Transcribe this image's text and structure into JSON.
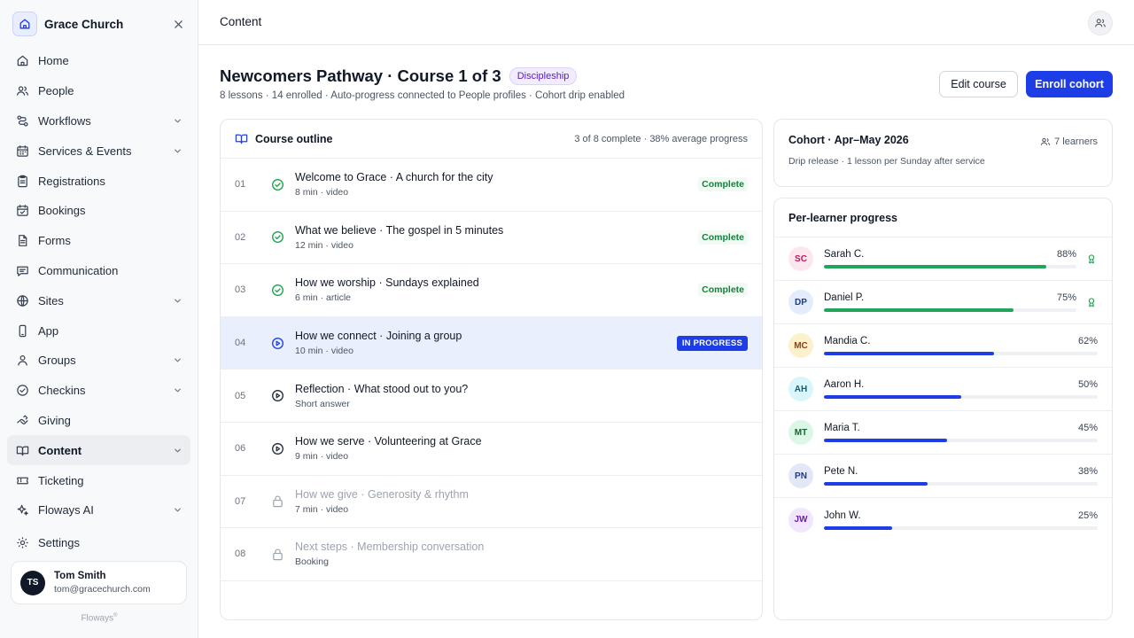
{
  "sidebar": {
    "org_name": "Grace Church",
    "nav": [
      {
        "label": "Home",
        "icon": "home-icon",
        "chevron": false
      },
      {
        "label": "People",
        "icon": "people-icon",
        "chevron": false
      },
      {
        "label": "Workflows",
        "icon": "workflows-icon",
        "chevron": true
      },
      {
        "label": "Services & Events",
        "icon": "calendar-icon",
        "chevron": true
      },
      {
        "label": "Registrations",
        "icon": "clipboard-icon",
        "chevron": false
      },
      {
        "label": "Bookings",
        "icon": "calendar-check-icon",
        "chevron": false
      },
      {
        "label": "Forms",
        "icon": "document-icon",
        "chevron": false
      },
      {
        "label": "Communication",
        "icon": "message-icon",
        "chevron": false
      },
      {
        "label": "Sites",
        "icon": "globe-icon",
        "chevron": true
      },
      {
        "label": "App",
        "icon": "phone-icon",
        "chevron": false
      },
      {
        "label": "Groups",
        "icon": "group-icon",
        "chevron": true
      },
      {
        "label": "Checkins",
        "icon": "check-circle-icon",
        "chevron": true
      },
      {
        "label": "Giving",
        "icon": "giving-icon",
        "chevron": false
      },
      {
        "label": "Content",
        "icon": "book-icon",
        "chevron": true,
        "active": true
      },
      {
        "label": "Ticketing",
        "icon": "ticket-icon",
        "chevron": false
      },
      {
        "label": "Floways AI",
        "icon": "sparkle-icon",
        "chevron": true
      }
    ],
    "settings_label": "Settings",
    "user": {
      "initials": "TS",
      "name": "Tom Smith",
      "email": "tom@gracechurch.com"
    },
    "footer_brand": "Floways",
    "footer_mark": "®"
  },
  "header": {
    "title": "Content"
  },
  "course": {
    "title": "Newcomers Pathway · Course 1 of 3",
    "tag": "Discipleship",
    "subtitle": "8 lessons · 14 enrolled · Auto-progress connected to People profiles · Cohort drip enabled",
    "edit_label": "Edit course",
    "enroll_label": "Enroll cohort"
  },
  "outline": {
    "title": "Course outline",
    "summary": "3 of 8 complete · 38% average progress",
    "lessons": [
      {
        "num": "01",
        "title": "Welcome to Grace · A church for the city",
        "sub": "8 min · video",
        "state": "complete",
        "status": "Complete"
      },
      {
        "num": "02",
        "title": "What we believe · The gospel in 5 minutes",
        "sub": "12 min · video",
        "state": "complete",
        "status": "Complete"
      },
      {
        "num": "03",
        "title": "How we worship · Sundays explained",
        "sub": "6 min · article",
        "state": "complete",
        "status": "Complete"
      },
      {
        "num": "04",
        "title": "How we connect · Joining a group",
        "sub": "10 min · video",
        "state": "current",
        "status": "IN PROGRESS"
      },
      {
        "num": "05",
        "title": "Reflection · What stood out to you?",
        "sub": "Short answer",
        "state": "open",
        "status": ""
      },
      {
        "num": "06",
        "title": "How we serve · Volunteering at Grace",
        "sub": "9 min · video",
        "state": "open",
        "status": ""
      },
      {
        "num": "07",
        "title": "How we give · Generosity & rhythm",
        "sub": "7 min · video",
        "state": "locked",
        "status": ""
      },
      {
        "num": "08",
        "title": "Next steps · Membership conversation",
        "sub": "Booking",
        "state": "locked",
        "status": ""
      }
    ]
  },
  "cohort": {
    "title": "Cohort · Apr–May 2026",
    "learners": "7 learners",
    "subtitle": "Drip release · 1 lesson per Sunday after service"
  },
  "progress": {
    "title": "Per-learner progress",
    "learners": [
      {
        "initials": "SC",
        "name": "Sarah C.",
        "pct_label": "88%",
        "pct": 88,
        "bar_color": "#22a55a",
        "avatar_bg": "#fde7ef",
        "avatar_fg": "#be185d",
        "award": true
      },
      {
        "initials": "DP",
        "name": "Daniel P.",
        "pct_label": "75%",
        "pct": 75,
        "bar_color": "#22a55a",
        "avatar_bg": "#e3ecfb",
        "avatar_fg": "#1e3a8a",
        "award": true
      },
      {
        "initials": "MC",
        "name": "Mandia C.",
        "pct_label": "62%",
        "pct": 62,
        "bar_color": "#1d3ee6",
        "avatar_bg": "#fdf0cc",
        "avatar_fg": "#92400e",
        "award": false
      },
      {
        "initials": "AH",
        "name": "Aaron H.",
        "pct_label": "50%",
        "pct": 50,
        "bar_color": "#1d3ee6",
        "avatar_bg": "#d8f6fb",
        "avatar_fg": "#155e75",
        "award": false
      },
      {
        "initials": "MT",
        "name": "Maria T.",
        "pct_label": "45%",
        "pct": 45,
        "bar_color": "#1d3ee6",
        "avatar_bg": "#dcf7e5",
        "avatar_fg": "#166534",
        "award": false
      },
      {
        "initials": "PN",
        "name": "Pete N.",
        "pct_label": "38%",
        "pct": 38,
        "bar_color": "#1d3ee6",
        "avatar_bg": "#e2e8f7",
        "avatar_fg": "#1e3a8a",
        "award": false
      },
      {
        "initials": "JW",
        "name": "John W.",
        "pct_label": "25%",
        "pct": 25,
        "bar_color": "#1d3ee6",
        "avatar_bg": "#f1e6fb",
        "avatar_fg": "#6b21a8",
        "award": false
      }
    ]
  }
}
